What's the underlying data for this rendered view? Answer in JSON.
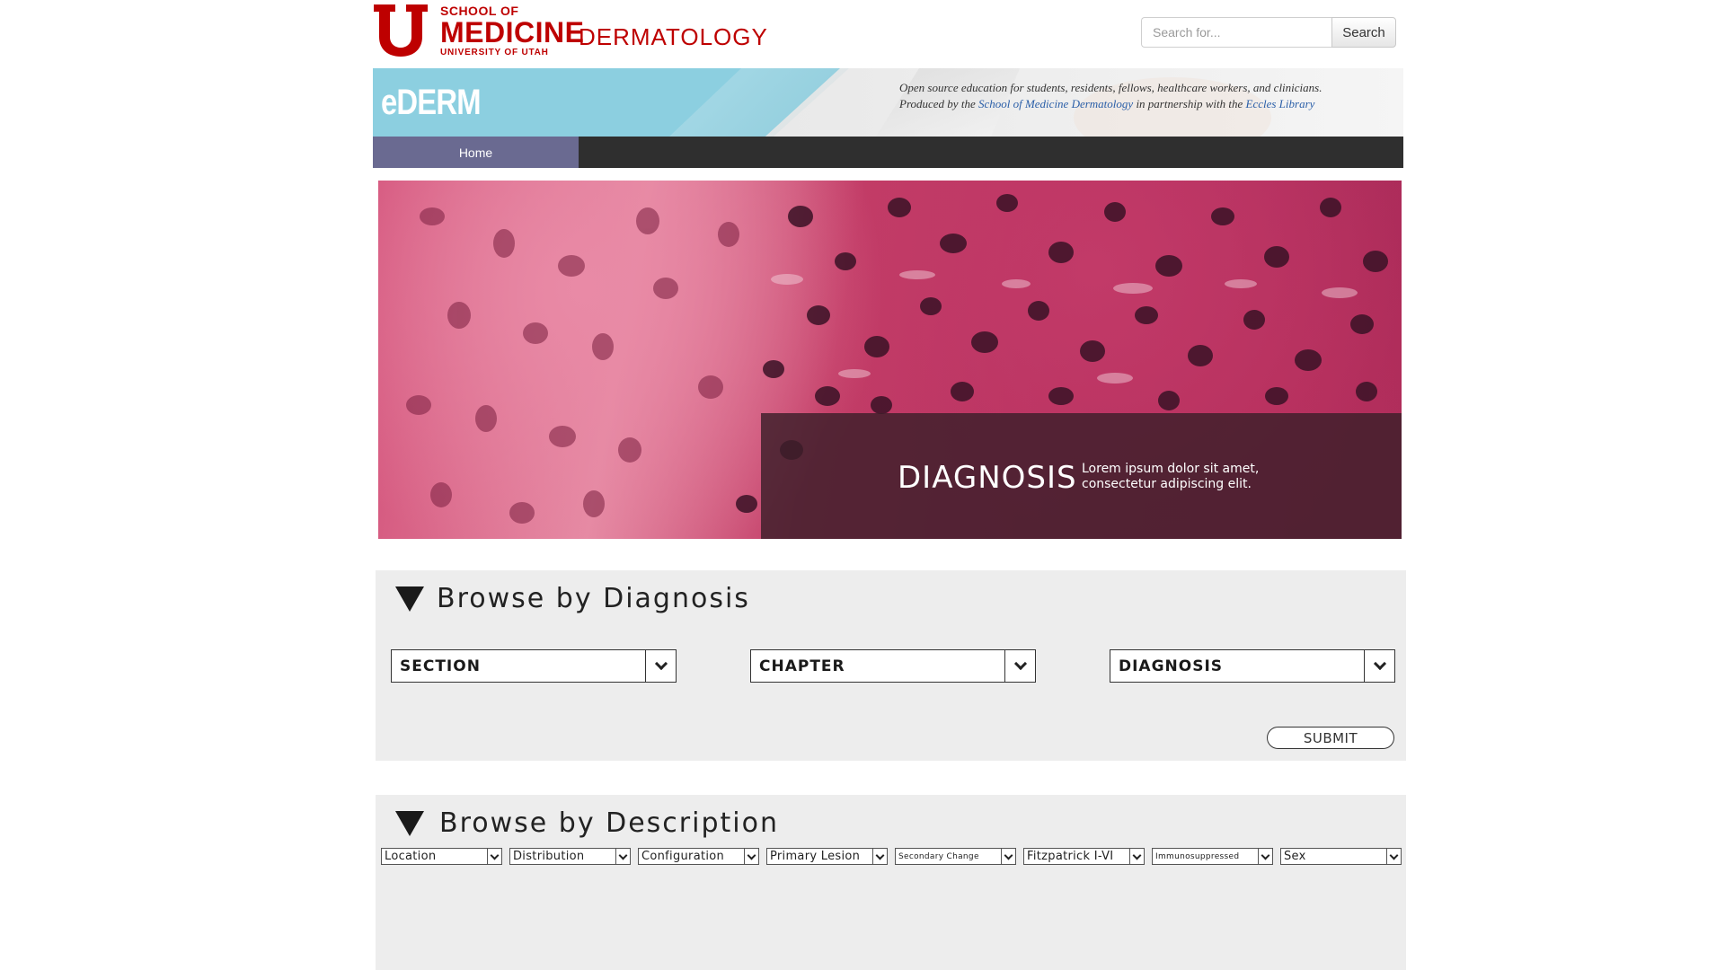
{
  "header": {
    "logo_line1": "SCHOOL OF",
    "logo_line2": "MEDICINE",
    "logo_line3": "UNIVERSITY OF UTAH",
    "department": "DERMATOLOGY",
    "search_placeholder": "Search for...",
    "search_button": "Search"
  },
  "banner": {
    "brand": "eDERM",
    "tagline_line1": "Open source education for students, residents, fellows, healthcare workers, and clinicians.",
    "tagline_prefix": "Produced by the ",
    "tagline_link1": "School of Medicine Dermatology",
    "tagline_middle": " in partnership with the ",
    "tagline_link2": "Eccles Library"
  },
  "nav": {
    "items": [
      {
        "label": "Home"
      }
    ]
  },
  "hero": {
    "title": "DIAGNOSIS",
    "text_line1": "Lorem ipsum dolor sit amet,",
    "text_line2": "consectetur adipiscing elit."
  },
  "browse_diagnosis": {
    "title": "Browse by Diagnosis",
    "dropdowns": [
      {
        "label": "SECTION"
      },
      {
        "label": "CHAPTER"
      },
      {
        "label": "DIAGNOSIS"
      }
    ],
    "submit": "SUBMIT"
  },
  "browse_description": {
    "title": "Browse by Description",
    "filters": [
      {
        "label": "Location"
      },
      {
        "label": "Distribution"
      },
      {
        "label": "Configuration"
      },
      {
        "label": "Primary Lesion"
      },
      {
        "label": "Secondary Change"
      },
      {
        "label": "Fitzpatrick I-VI"
      },
      {
        "label": "Immunosuppressed"
      },
      {
        "label": "Sex"
      }
    ]
  },
  "colors": {
    "brand_red": "#be0000",
    "nav_active": "#6a6a91",
    "nav_bar": "#2f2f2f",
    "banner_blue": "#8ccfe0",
    "panel_bg": "#ededed"
  }
}
